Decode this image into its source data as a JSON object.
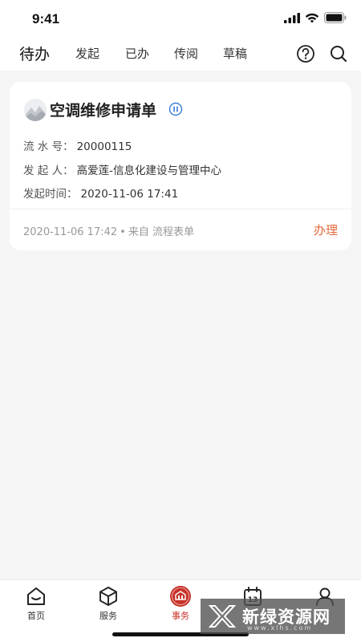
{
  "status": {
    "time": "9:41"
  },
  "nav": {
    "tabs": [
      {
        "label": "待办",
        "active": true
      },
      {
        "label": "发起"
      },
      {
        "label": "已办"
      },
      {
        "label": "传阅"
      },
      {
        "label": "草稿"
      }
    ],
    "icons": [
      "help-icon",
      "search-icon"
    ]
  },
  "card": {
    "title": "空调维修申请单",
    "status_icon": "pause-icon",
    "fields": [
      {
        "label": "流 水 号：",
        "value": "20000115"
      },
      {
        "label": "发 起 人：",
        "value": "高爱莲-信息化建设与管理中心"
      },
      {
        "label": "发起时间：",
        "value": "2020-11-06 17:41"
      }
    ],
    "footer": {
      "time": "2020-11-06 17:42",
      "separator": "•",
      "source": "来自 流程表单"
    },
    "action_label": "办理"
  },
  "bottom_nav": {
    "items": [
      {
        "label": "首页",
        "icon": "home-icon"
      },
      {
        "label": "服务",
        "icon": "box-icon"
      },
      {
        "label": "事务",
        "icon": "affairs-icon",
        "active": true
      },
      {
        "label": "",
        "icon": "calendar-icon",
        "icon_text": "13"
      },
      {
        "label": "",
        "icon": "user-icon"
      }
    ]
  },
  "watermark": {
    "text": "新绿资源网",
    "subtext": "www.xlhs.com"
  },
  "colors": {
    "accent": "#e2683a",
    "active_nav": "#c8332b",
    "status_blue": "#3a7bd5"
  }
}
